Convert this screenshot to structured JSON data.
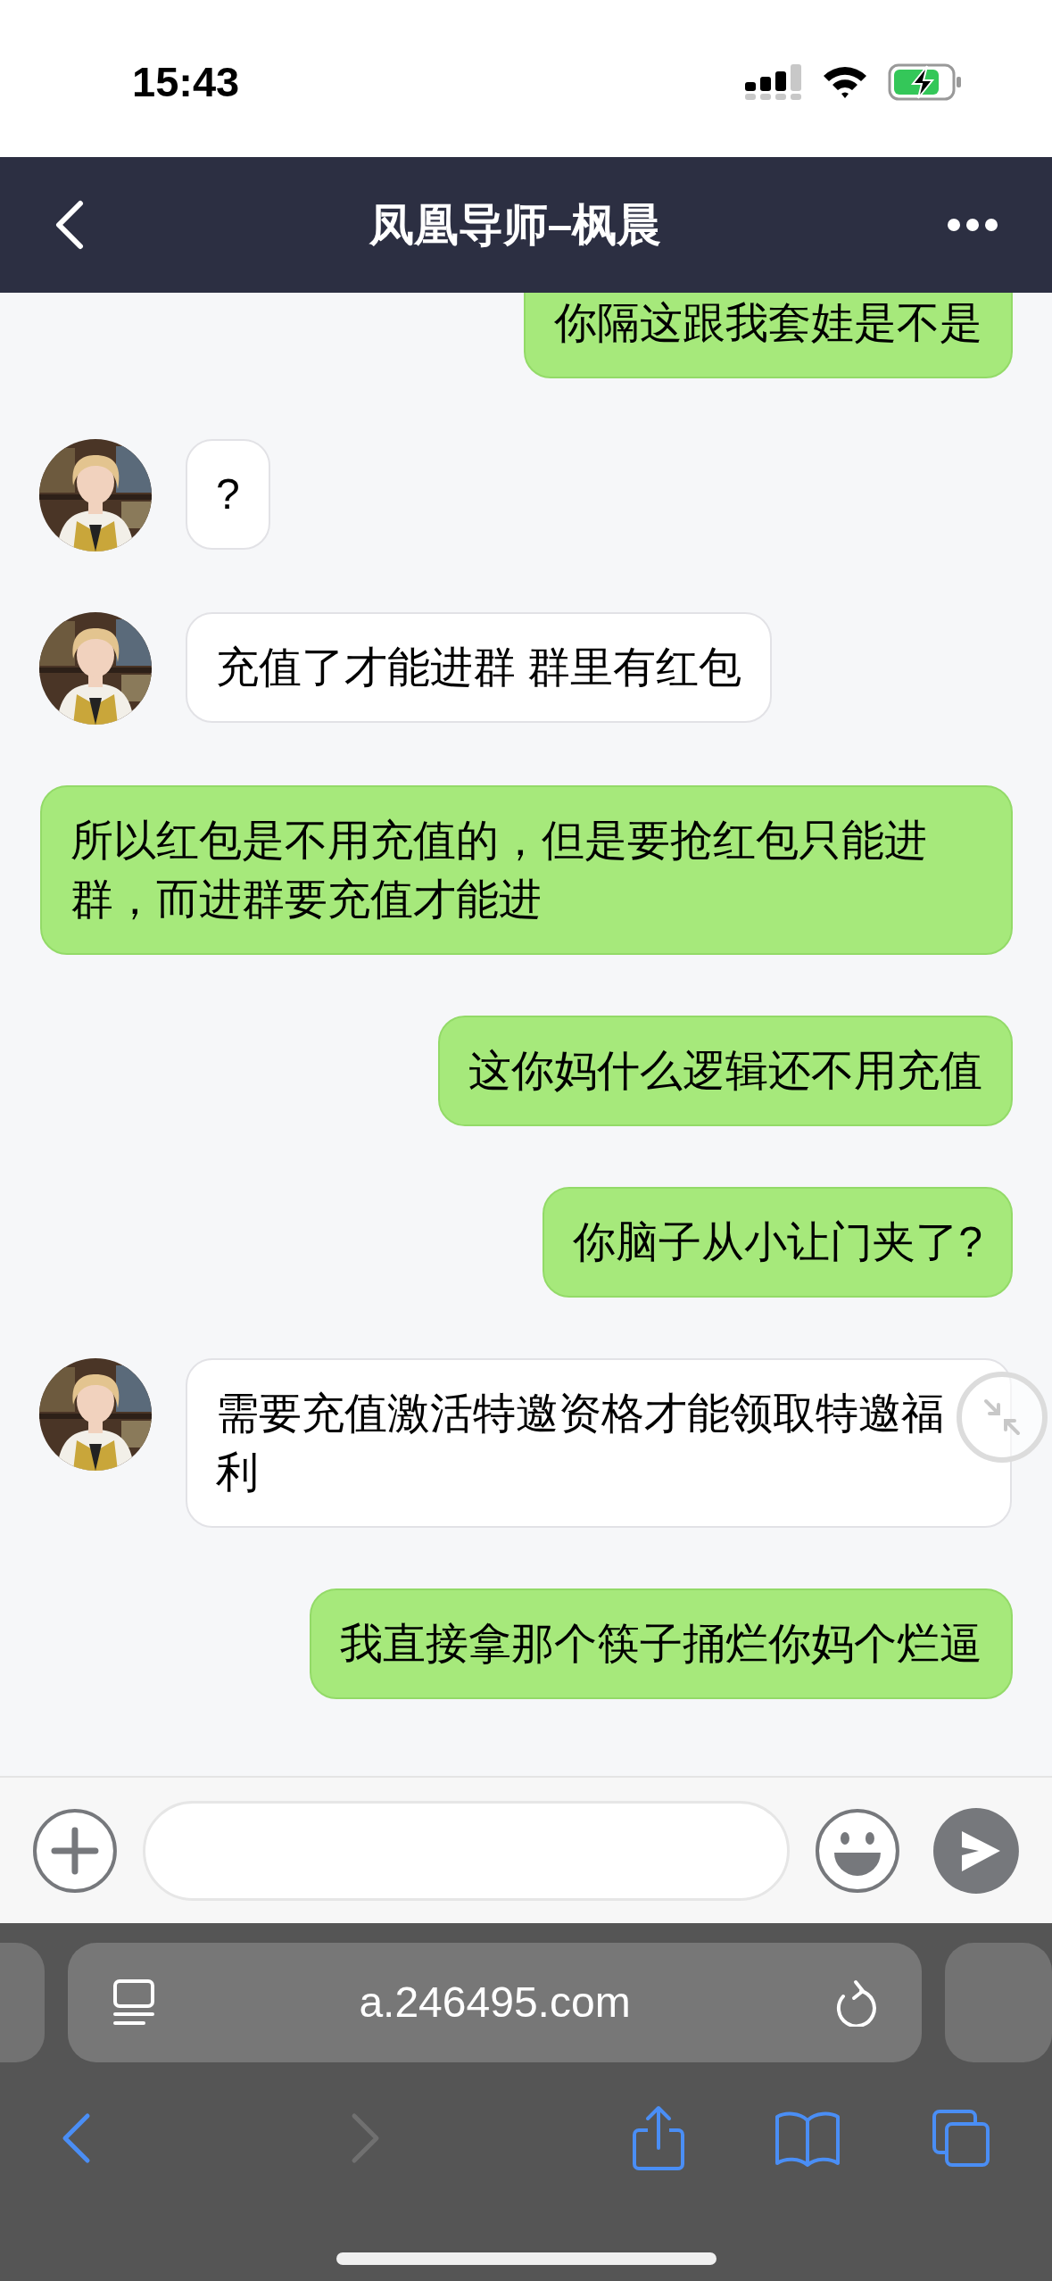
{
  "status_bar": {
    "time": "15:43"
  },
  "header": {
    "title": "凤凰导师–枫晨"
  },
  "messages": [
    {
      "kind": "sent",
      "text": "你隔这跟我套娃是不是"
    },
    {
      "kind": "received",
      "text": "?"
    },
    {
      "kind": "received",
      "text": "充值了才能进群 群里有红包"
    },
    {
      "kind": "sent",
      "text": "所以红包是不用充值的，但是要抢红包只能进群，而进群要充值才能进"
    },
    {
      "kind": "sent",
      "text": "这你妈什么逻辑还不用充值"
    },
    {
      "kind": "sent",
      "text": "你脑子从小让门夹了?"
    },
    {
      "kind": "received",
      "text": "需要充值激活特邀资格才能领取特邀福利"
    },
    {
      "kind": "sent",
      "text": "我直接拿那个筷子捅烂你妈个烂逼"
    }
  ],
  "browser": {
    "url": "a.246495.com",
    "back_enabled": true,
    "forward_enabled": false
  }
}
